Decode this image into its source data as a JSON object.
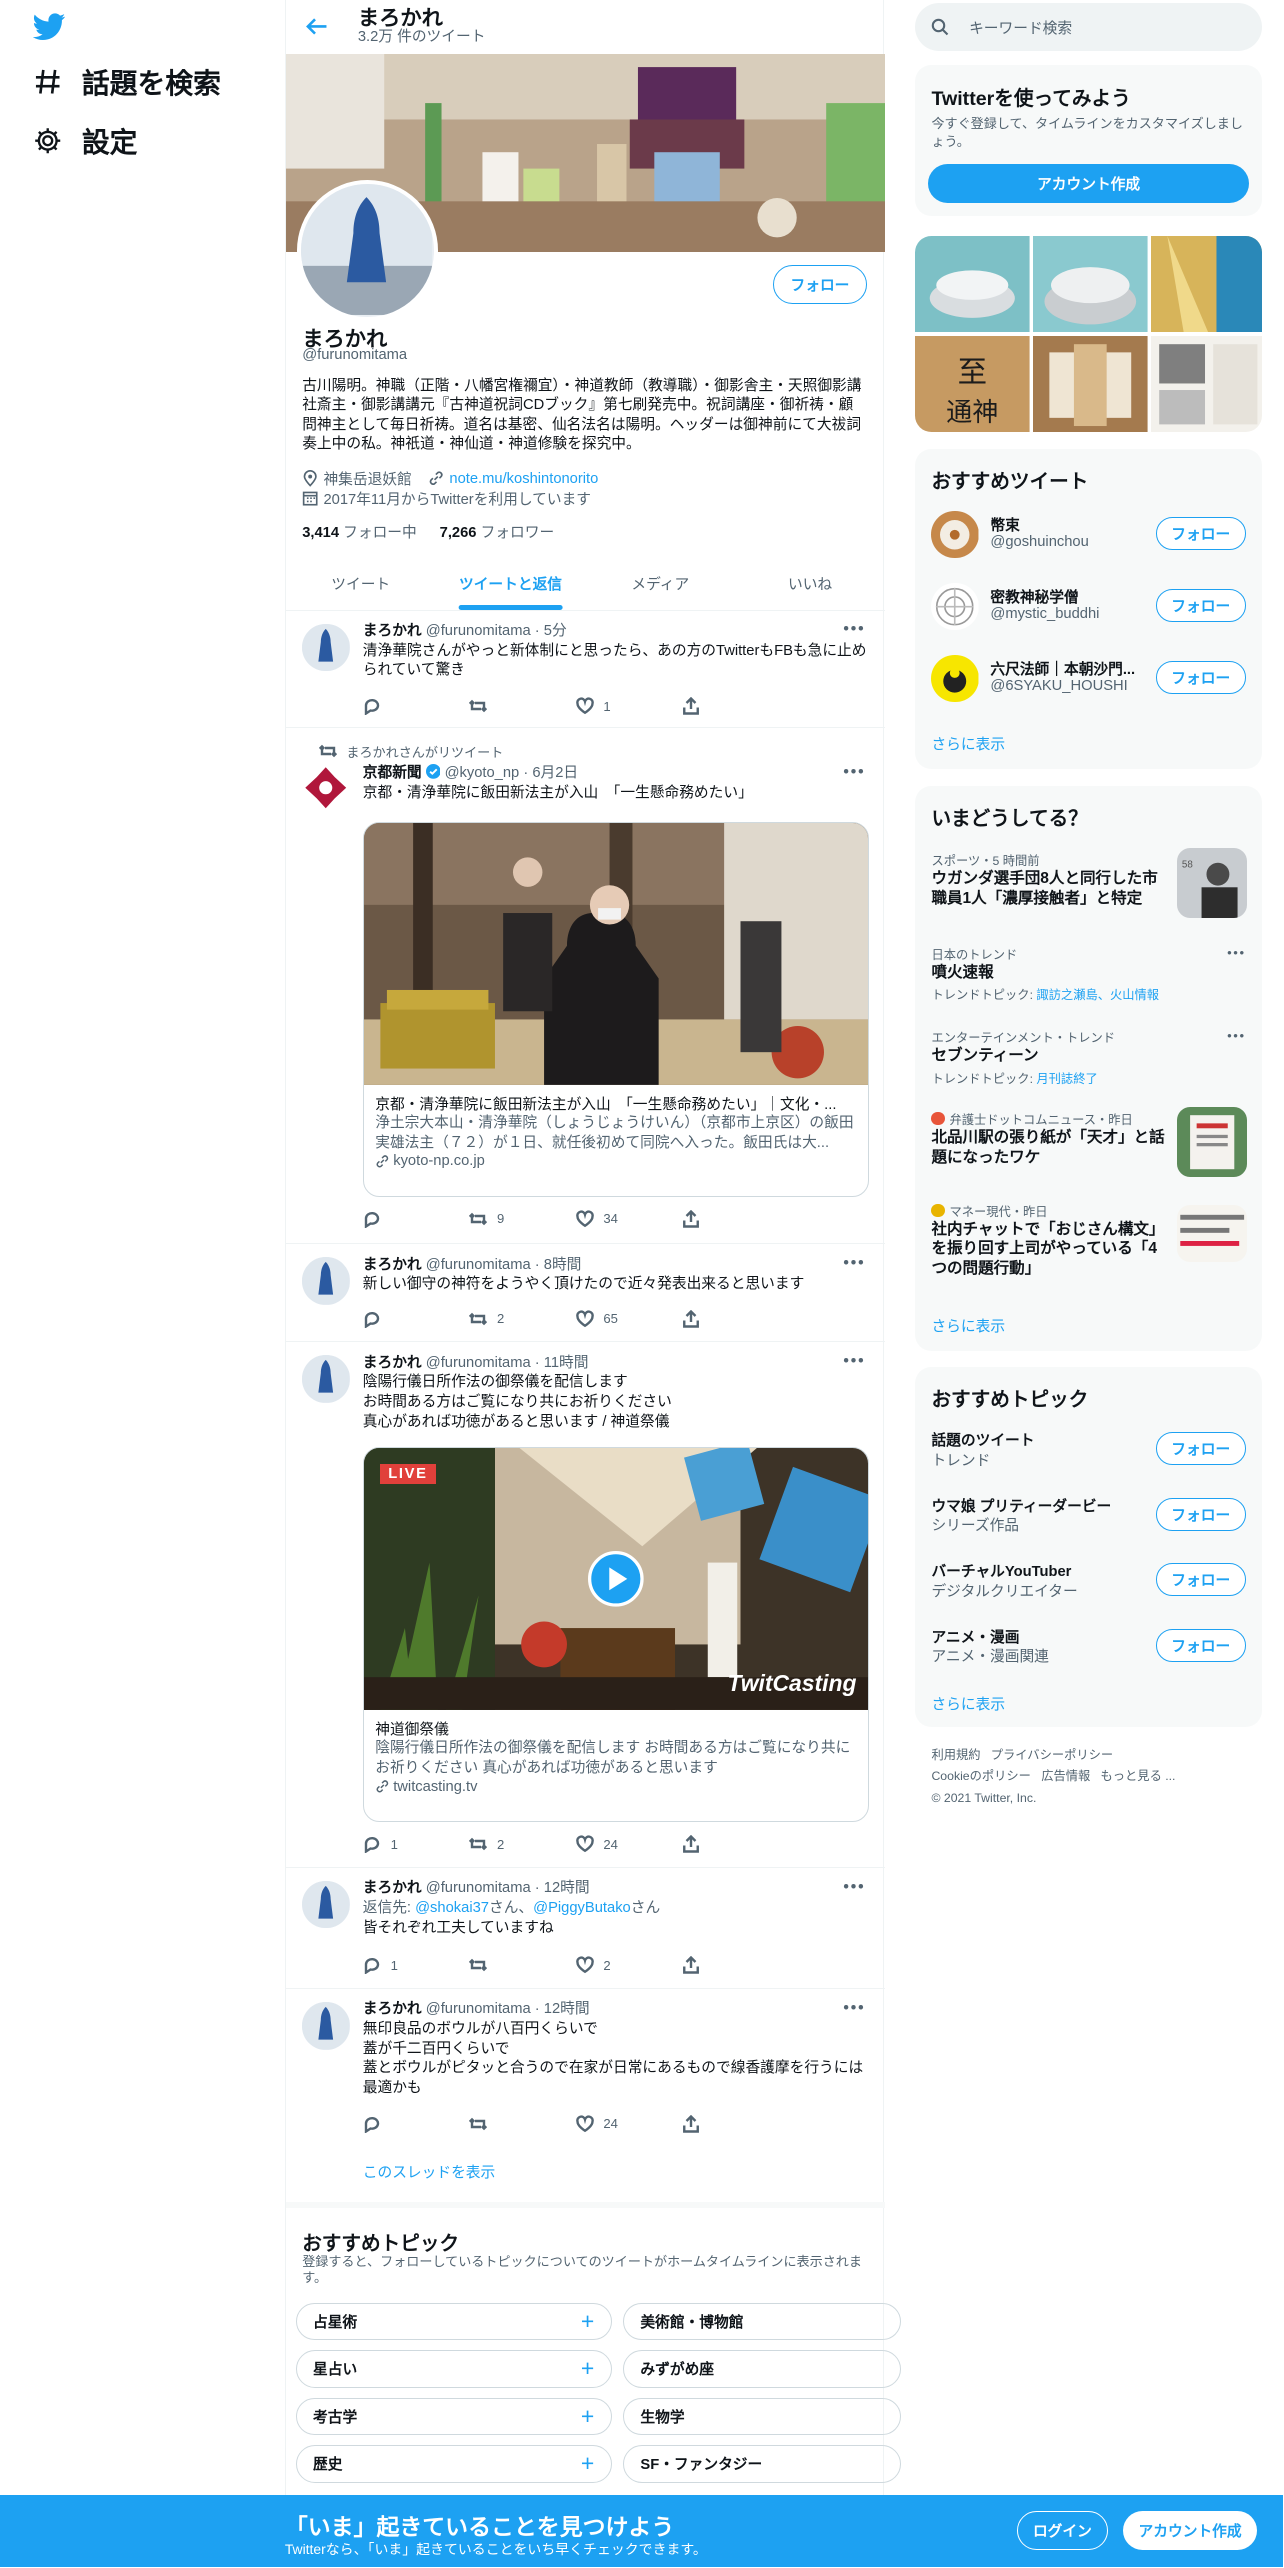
{
  "nav": {
    "explore": "話題を検索",
    "settings": "設定"
  },
  "profile": {
    "name": "まろかれ",
    "tweet_count": "3.2万 件のツイート",
    "handle": "@furunomitama",
    "follow": "フォロー",
    "bio": "古川陽明。神職（正階・八幡宮権禰宜）・神道教師（教導職）・御影舎主・天照御影講社斎主・御影講講元『古神道祝詞CDブック』第七刷発売中。祝詞講座・御祈祷・顧問神主として毎日祈祷。道名は基密、仙名法名は陽明。ヘッダーは御神前にて大祓詞奏上中の私。神祇道・神仙道・神道修験を探究中。",
    "location": "神集岳退妖館",
    "link": "note.mu/koshintonorito",
    "joined": "2017年11月からTwitterを利用しています",
    "following_num": "3,414",
    "following_label": "フォロー中",
    "followers_num": "7,266",
    "followers_label": "フォロワー"
  },
  "tabs": [
    "ツイート",
    "ツイートと返信",
    "メディア",
    "いいね"
  ],
  "tweets": [
    {
      "name": "まろかれ",
      "handle": "@furunomitama",
      "time": "5分",
      "text": "清浄華院さんがやっと新体制にと思ったら、あの方のTwitterもFBも急に止められていて驚き",
      "reply": "",
      "retweet": "",
      "like": "1"
    },
    {
      "rt_label": "まろかれさんがリツイート",
      "name": "京都新聞",
      "handle": "@kyoto_np",
      "time": "6月2日",
      "text": "京都・清浄華院に飯田新法主が入山　「一生懸命務めたい」",
      "card_title": "京都・清浄華院に飯田新法主が入山　「一生懸命務めたい」｜文化・...",
      "card_desc": "浄土宗大本山・清浄華院（しょうじょうけいん）（京都市上京区）の飯田実雄法主（７２）が１日、就任後初めて同院へ入った。飯田氏は大...",
      "card_url": "kyoto-np.co.jp",
      "reply": "",
      "retweet": "9",
      "like": "34"
    },
    {
      "name": "まろかれ",
      "handle": "@furunomitama",
      "time": "8時間",
      "text": "新しい御守の神符をようやく頂けたので近々発表出来ると思います",
      "reply": "",
      "retweet": "2",
      "like": "65"
    },
    {
      "name": "まろかれ",
      "handle": "@furunomitama",
      "time": "11時間",
      "text": "陰陽行儀日所作法の御祭儀を配信します\nお時間ある方はご覧になり共にお祈りください\n真心があれば功徳があると思います / 神道祭儀",
      "live": "LIVE",
      "brand": "TwitCasting",
      "card_title": "神道御祭儀",
      "card_desc": "陰陽行儀日所作法の御祭儀を配信します お時間ある方はご覧になり共にお祈りください 真心があれば功徳があると思います",
      "card_url": "twitcasting.tv",
      "reply": "1",
      "retweet": "2",
      "like": "24"
    },
    {
      "name": "まろかれ",
      "handle": "@furunomitama",
      "time": "12時間",
      "reply_to_prefix": "返信先: ",
      "reply_to_1": "@shokai37",
      "reply_to_mid": "さん、",
      "reply_to_2": "@PiggyButako",
      "reply_to_suffix": "さん",
      "text": "皆それぞれ工夫していますね",
      "reply": "1",
      "retweet": "",
      "like": "2"
    },
    {
      "name": "まろかれ",
      "handle": "@furunomitama",
      "time": "12時間",
      "text": "無印良品のボウルが八百円くらいで\n蓋が千二百円くらいで\n蓋とボウルがピタッと合うので在家が日常にあるもので線香護摩を行うには最適かも",
      "reply": "",
      "retweet": "",
      "like": "24",
      "show_thread": "このスレッドを表示"
    }
  ],
  "topics_section": {
    "title": "おすすめトピック",
    "desc": "登録すると、フォローしているトピックについてのツイートがホームタイムラインに表示されます。",
    "left": [
      "占星術",
      "星占い",
      "考古学",
      "歴史"
    ],
    "right": [
      "美術館・博物館",
      "みずがめ座",
      "生物学",
      "SF・ファンタジー"
    ]
  },
  "search": {
    "placeholder": "キーワード検索"
  },
  "signup_box": {
    "title": "Twitterを使ってみよう",
    "desc": "今すぐ登録して、タイムラインをカスタマイズしましょう。",
    "button": "アカウント作成"
  },
  "recommended": {
    "title": "おすすめツイート",
    "users": [
      {
        "name": "幣束",
        "handle": "@goshuinchou",
        "follow": "フォロー"
      },
      {
        "name": "密教神秘学僧",
        "handle": "@mystic_buddhi",
        "follow": "フォロー"
      },
      {
        "name": "六尺法師｜本朝沙門...",
        "handle": "@6SYAKU_HOUSHI",
        "follow": "フォロー"
      }
    ],
    "more": "さらに表示"
  },
  "trends": {
    "title": "いまどうしてる？",
    "items": [
      {
        "cat": "スポーツ・5 時間前",
        "title": "ウガンダ選手団8人と同行した市職員1人「濃厚接触者」と特定",
        "sub": ""
      },
      {
        "cat": "日本のトレンド",
        "title": "噴火速報",
        "sub_prefix": "トレンドトピック: ",
        "sub": "諏訪之瀬島、火山情報"
      },
      {
        "cat": "エンターテインメント・トレンド",
        "title": "セブンティーン",
        "sub_prefix": "トレンドトピック: ",
        "sub": "月刊誌終了"
      },
      {
        "cat": "弁護士ドットコムニュース・昨日",
        "title": "北品川駅の張り紙が「天才」と話題になったワケ",
        "sub": ""
      },
      {
        "cat": "マネー現代・昨日",
        "title": "社内チャットで「おじさん構文」を振り回す上司がやっている「4つの問題行動」",
        "sub": ""
      }
    ],
    "more": "さらに表示"
  },
  "topics": {
    "title": "おすすめトピック",
    "items": [
      {
        "name": "話題のツイート",
        "sub": "トレンド",
        "follow": "フォロー"
      },
      {
        "name": "ウマ娘 プリティーダービー",
        "sub": "シリーズ作品",
        "follow": "フォロー"
      },
      {
        "name": "バーチャルYouTuber",
        "sub": "デジタルクリエイター",
        "follow": "フォロー"
      },
      {
        "name": "アニメ・漫画",
        "sub": "アニメ・漫画関連",
        "follow": "フォロー"
      }
    ],
    "more": "さらに表示"
  },
  "footer": {
    "l1": "利用規約",
    "l2": "プライバシーポリシー",
    "l3": "Cookieのポリシー",
    "l4": "広告情報",
    "l5": "もっと見る ...",
    "copy": "© 2021 Twitter, Inc."
  },
  "bottom": {
    "title": "「いま」起きていることを見つけよう",
    "sub": "Twitterなら、「いま」起きていることをいち早くチェックできます。",
    "login": "ログイン",
    "signup": "アカウント作成"
  },
  "colors": {
    "accent": "#1da1f2"
  }
}
